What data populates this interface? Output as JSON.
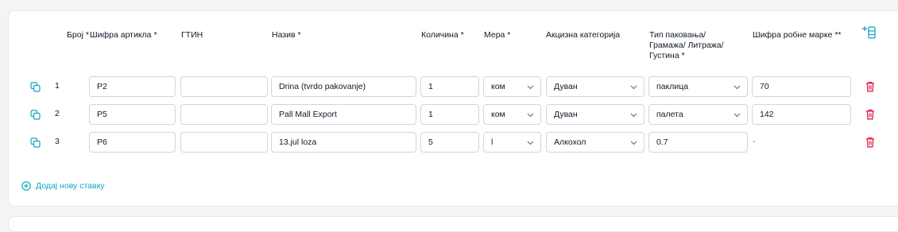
{
  "headers": {
    "broj": "Број *",
    "sifra": "Шифра артикла *",
    "gtin": "ГТИН",
    "naziv": "Назив *",
    "kolicina": "Количина *",
    "mera": "Мера *",
    "akcizna": "Акцизна категорија",
    "tip_line1": "Тип паковања/",
    "tip_line2": "Грамажа/ Литража/",
    "tip_line3": "Густина *",
    "marka": "Шифра робне марке **"
  },
  "rows": [
    {
      "num": "1",
      "sifra": "P2",
      "gtin": "",
      "naziv": "Drina (tvrdo pakovanje)",
      "kolicina": "1",
      "mera": "ком",
      "akcizna": "Дуван",
      "tip": "паклица",
      "marka": "70"
    },
    {
      "num": "2",
      "sifra": "P5",
      "gtin": "",
      "naziv": "Pall Mall Export",
      "kolicina": "1",
      "mera": "ком",
      "akcizna": "Дуван",
      "tip": "палета",
      "marka": "142"
    },
    {
      "num": "3",
      "sifra": "P6",
      "gtin": "",
      "naziv": "13.jul loza",
      "kolicina": "5",
      "mera": "l",
      "akcizna": "Алкохол",
      "tip": "0.7",
      "marka": "-"
    }
  ],
  "add_item_label": "Додај нову ставку",
  "colors": {
    "accent": "#0ea5c6",
    "danger": "#e11d48",
    "border": "#d1d5db"
  },
  "icons": {
    "copy": "copy-icon",
    "trash": "trash-icon",
    "chevron": "chevron-down-icon",
    "add_column": "add-column-icon",
    "plus_circle": "plus-circle-icon"
  }
}
